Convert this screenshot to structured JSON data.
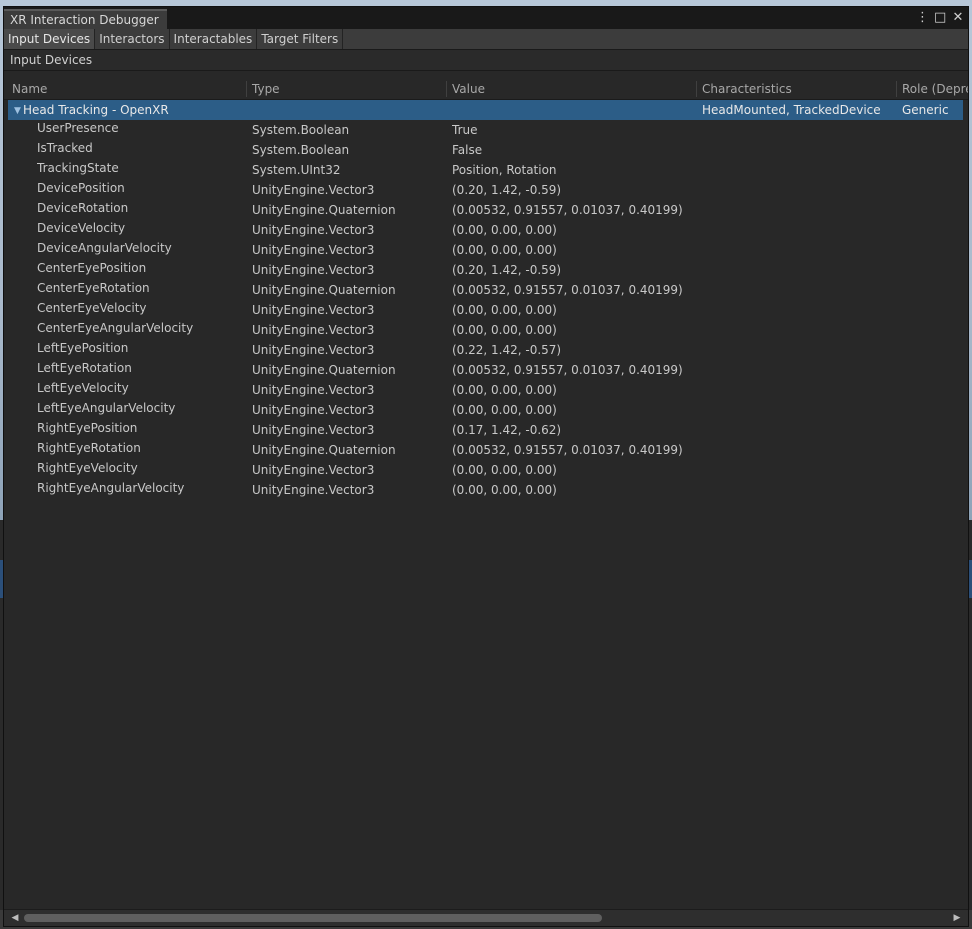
{
  "window": {
    "title": "XR Interaction Debugger"
  },
  "title_icons": {
    "menu": "⋮",
    "maximize": "□",
    "close": "✕"
  },
  "tabs": [
    {
      "label": "Input Devices",
      "active": true
    },
    {
      "label": "Interactors",
      "active": false
    },
    {
      "label": "Interactables",
      "active": false
    },
    {
      "label": "Target Filters",
      "active": false
    }
  ],
  "section": {
    "title": "Input Devices"
  },
  "columns": {
    "name": "Name",
    "type": "Type",
    "value": "Value",
    "characteristics": "Characteristics",
    "role": "Role (Depre"
  },
  "device": {
    "name": "Head Tracking - OpenXR",
    "characteristics": "HeadMounted, TrackedDevice",
    "role": "Generic",
    "foldout_icon": "triangle-down-icon"
  },
  "features": [
    {
      "name": "UserPresence",
      "type": "System.Boolean",
      "value": "True"
    },
    {
      "name": "IsTracked",
      "type": "System.Boolean",
      "value": "False"
    },
    {
      "name": "TrackingState",
      "type": "System.UInt32",
      "value": "Position, Rotation"
    },
    {
      "name": "DevicePosition",
      "type": "UnityEngine.Vector3",
      "value": "(0.20, 1.42, -0.59)"
    },
    {
      "name": "DeviceRotation",
      "type": "UnityEngine.Quaternion",
      "value": "(0.00532, 0.91557, 0.01037, 0.40199)"
    },
    {
      "name": "DeviceVelocity",
      "type": "UnityEngine.Vector3",
      "value": "(0.00, 0.00, 0.00)"
    },
    {
      "name": "DeviceAngularVelocity",
      "type": "UnityEngine.Vector3",
      "value": "(0.00, 0.00, 0.00)"
    },
    {
      "name": "CenterEyePosition",
      "type": "UnityEngine.Vector3",
      "value": "(0.20, 1.42, -0.59)"
    },
    {
      "name": "CenterEyeRotation",
      "type": "UnityEngine.Quaternion",
      "value": "(0.00532, 0.91557, 0.01037, 0.40199)"
    },
    {
      "name": "CenterEyeVelocity",
      "type": "UnityEngine.Vector3",
      "value": "(0.00, 0.00, 0.00)"
    },
    {
      "name": "CenterEyeAngularVelocity",
      "type": "UnityEngine.Vector3",
      "value": "(0.00, 0.00, 0.00)"
    },
    {
      "name": "LeftEyePosition",
      "type": "UnityEngine.Vector3",
      "value": "(0.22, 1.42, -0.57)"
    },
    {
      "name": "LeftEyeRotation",
      "type": "UnityEngine.Quaternion",
      "value": "(0.00532, 0.91557, 0.01037, 0.40199)"
    },
    {
      "name": "LeftEyeVelocity",
      "type": "UnityEngine.Vector3",
      "value": "(0.00, 0.00, 0.00)"
    },
    {
      "name": "LeftEyeAngularVelocity",
      "type": "UnityEngine.Vector3",
      "value": "(0.00, 0.00, 0.00)"
    },
    {
      "name": "RightEyePosition",
      "type": "UnityEngine.Vector3",
      "value": "(0.17, 1.42, -0.62)"
    },
    {
      "name": "RightEyeRotation",
      "type": "UnityEngine.Quaternion",
      "value": "(0.00532, 0.91557, 0.01037, 0.40199)"
    },
    {
      "name": "RightEyeVelocity",
      "type": "UnityEngine.Vector3",
      "value": "(0.00, 0.00, 0.00)"
    },
    {
      "name": "RightEyeAngularVelocity",
      "type": "UnityEngine.Vector3",
      "value": "(0.00, 0.00, 0.00)"
    }
  ],
  "scrollbar": {
    "left_arrow": "◀",
    "right_arrow": "▶"
  },
  "colors": {
    "selection": "#2c5d87",
    "panel": "#282828",
    "text": "#c8c8c8"
  }
}
